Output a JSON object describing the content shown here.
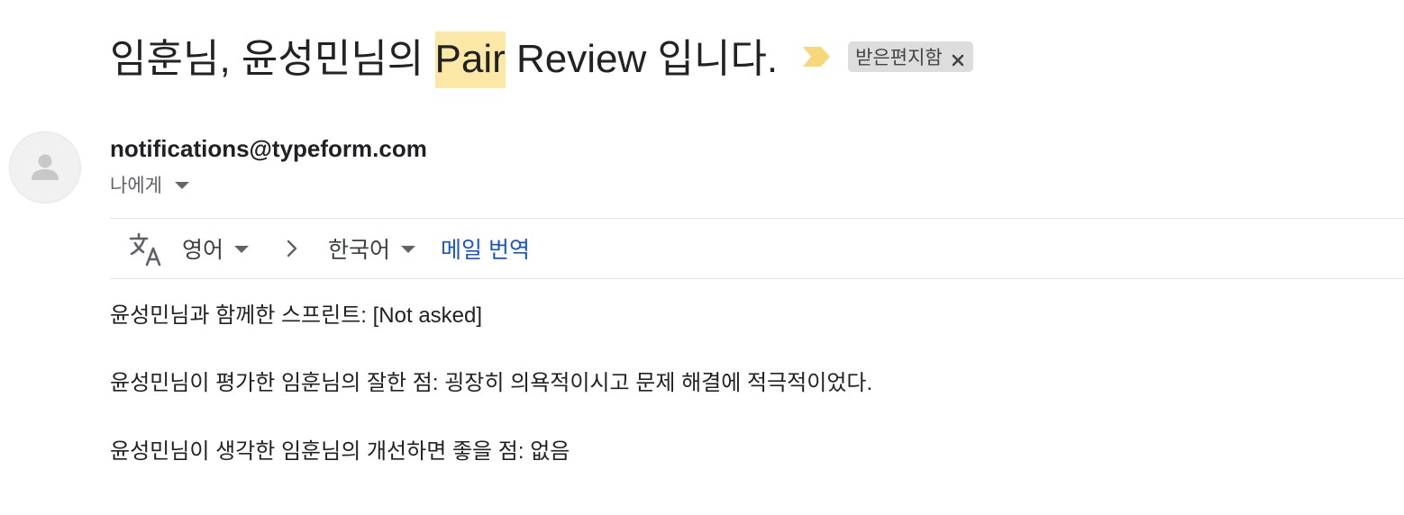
{
  "email": {
    "subject_before": "임훈님, 윤성민님의 ",
    "subject_highlight": "Pair",
    "subject_after": " Review 입니다.",
    "importance_icon": "importance-marker-icon",
    "label": "받은편지함",
    "sender": "notifications@typeform.com",
    "recipient": "나에게",
    "body": [
      "윤성민님과 함께한 스프린트: [Not asked]",
      "윤성민님이 평가한 임훈님의 잘한 점: 굉장히 의욕적이시고 문제 해결에 적극적이었다.",
      "윤성민님이 생각한 임훈님의 개선하면 좋을 점: 없음"
    ]
  },
  "translate": {
    "source_lang": "영어",
    "target_lang": "한국어",
    "link": "메일 번역"
  },
  "colors": {
    "highlight": "#fce8a6",
    "importance": "#f6d77a",
    "link": "#1a56c4",
    "chip": "#dddddd"
  }
}
